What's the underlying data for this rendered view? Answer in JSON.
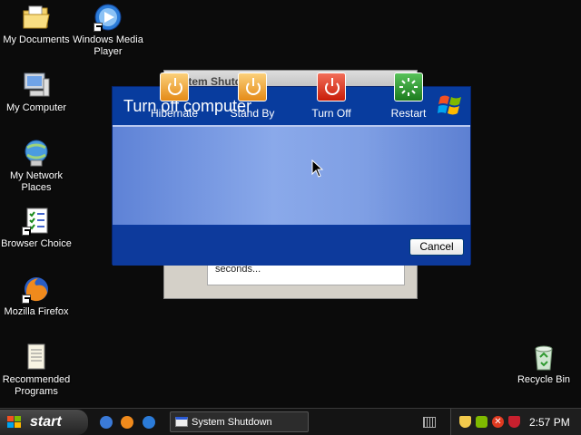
{
  "desktop": {
    "icons": [
      {
        "label": "My Documents",
        "icon": "folder-documents-icon"
      },
      {
        "label": "Windows Media Player",
        "icon": "media-player-icon"
      },
      {
        "label": "My Computer",
        "icon": "computer-icon"
      },
      {
        "label": "My Network Places",
        "icon": "network-places-icon"
      },
      {
        "label": "Browser Choice",
        "icon": "browser-choice-icon"
      },
      {
        "label": "Mozilla Firefox",
        "icon": "firefox-icon"
      },
      {
        "label": "Recommended Programs",
        "icon": "recommended-programs-icon"
      },
      {
        "label": "Recycle Bin",
        "icon": "recycle-bin-icon"
      }
    ]
  },
  "background_window": {
    "title": "System Shutdown",
    "body_text": "seconds..."
  },
  "dialog": {
    "title": "Turn off computer",
    "options": [
      {
        "label": "Hibernate",
        "icon": "power-icon",
        "color": "#f0a030"
      },
      {
        "label": "Stand By",
        "icon": "power-icon",
        "color": "#f0a030"
      },
      {
        "label": "Turn Off",
        "icon": "power-icon",
        "color": "#e03a20"
      },
      {
        "label": "Restart",
        "icon": "restart-icon",
        "color": "#2f9a30"
      }
    ],
    "cancel_label": "Cancel"
  },
  "taskbar": {
    "start_label": "start",
    "task_button_label": "System Shutdown",
    "clock": "2:57 PM"
  }
}
